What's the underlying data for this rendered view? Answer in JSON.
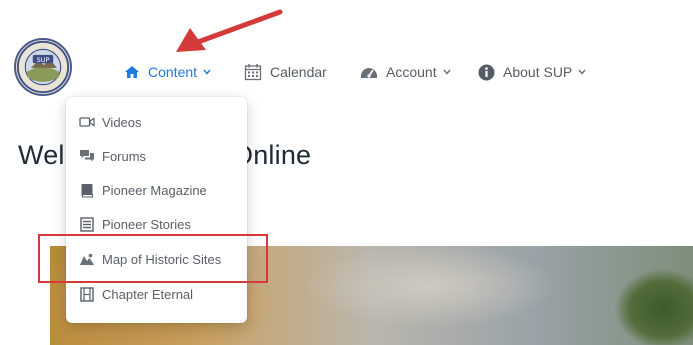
{
  "nav": {
    "content_label": "Content",
    "calendar_label": "Calendar",
    "account_label": "Account",
    "about_label": "About SUP"
  },
  "logo": {
    "text": "SUP"
  },
  "page": {
    "title_left": "Wel",
    "title_right": "Online"
  },
  "dropdown": {
    "items": [
      {
        "label": "Videos",
        "icon": "video-icon"
      },
      {
        "label": "Forums",
        "icon": "comments-icon"
      },
      {
        "label": "Pioneer Magazine",
        "icon": "book-icon"
      },
      {
        "label": "Pioneer Stories",
        "icon": "list-icon"
      },
      {
        "label": "Map of Historic Sites",
        "icon": "map-icon"
      },
      {
        "label": "Chapter Eternal",
        "icon": "film-icon"
      }
    ]
  },
  "colors": {
    "accent": "#1e7be0",
    "annotation": "#d43a3a",
    "text": "#555c66"
  }
}
